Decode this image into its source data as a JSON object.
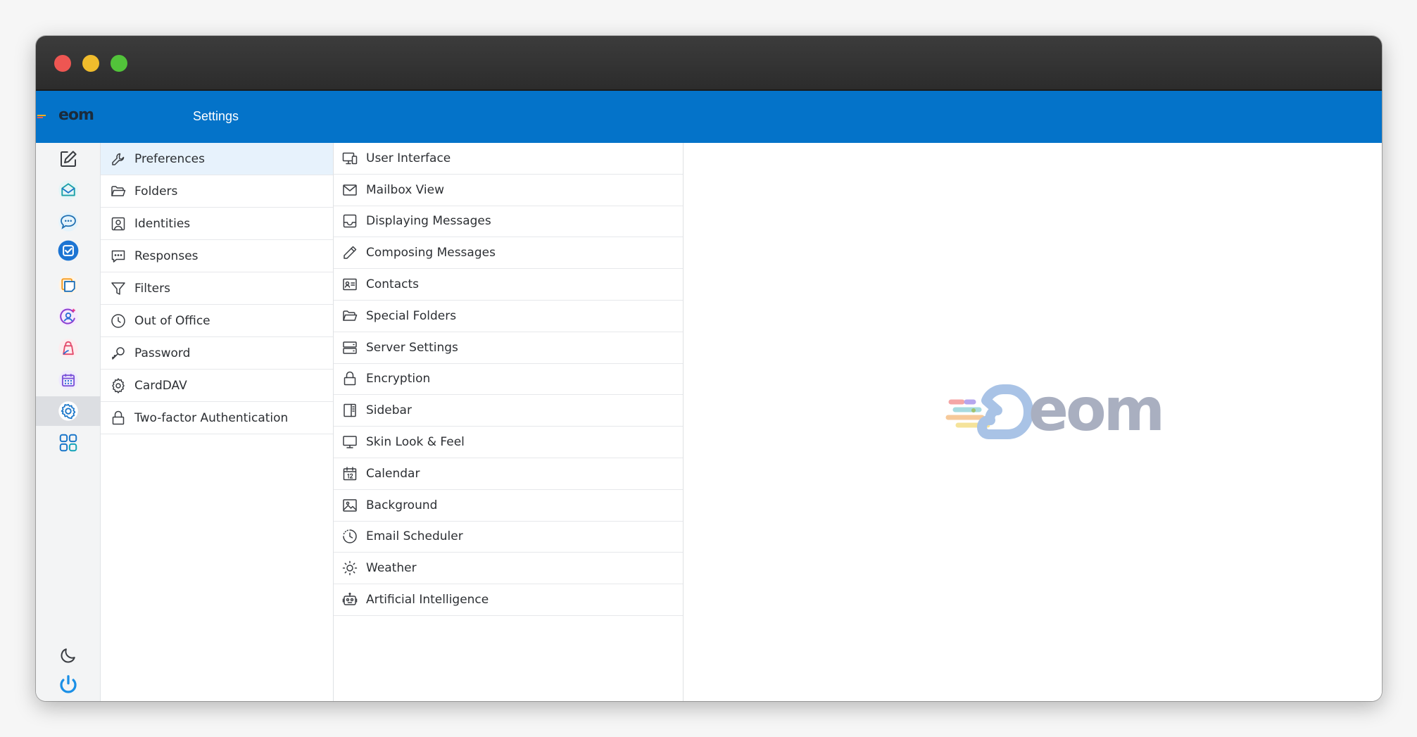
{
  "window": {
    "controls": [
      "close",
      "minimize",
      "maximize"
    ]
  },
  "app": {
    "logo_text": "eom",
    "page_title": "Settings",
    "brand_color": "#0473c9"
  },
  "rail": {
    "items": [
      {
        "name": "compose",
        "icon": "compose-icon"
      },
      {
        "name": "mail",
        "icon": "mail-icon"
      },
      {
        "name": "chat",
        "icon": "chat-icon"
      },
      {
        "name": "tasks",
        "icon": "tasks-icon"
      },
      {
        "name": "notes",
        "icon": "notes-icon"
      },
      {
        "name": "contacts",
        "icon": "contacts-icon"
      },
      {
        "name": "drive",
        "icon": "drive-icon"
      },
      {
        "name": "calendar",
        "icon": "calendar-icon"
      },
      {
        "name": "settings",
        "icon": "gear-icon",
        "active": true
      },
      {
        "name": "apps",
        "icon": "apps-grid-icon"
      }
    ],
    "bottom": [
      {
        "name": "dark-mode",
        "icon": "moon-icon"
      },
      {
        "name": "logout",
        "icon": "power-icon"
      }
    ]
  },
  "sections": [
    {
      "label": "Preferences",
      "icon": "wrench-icon",
      "selected": true
    },
    {
      "label": "Folders",
      "icon": "folder-icon"
    },
    {
      "label": "Identities",
      "icon": "identity-icon"
    },
    {
      "label": "Responses",
      "icon": "responses-icon"
    },
    {
      "label": "Filters",
      "icon": "filter-icon"
    },
    {
      "label": "Out of Office",
      "icon": "clock-icon"
    },
    {
      "label": "Password",
      "icon": "key-icon"
    },
    {
      "label": "CardDAV",
      "icon": "gear-icon"
    },
    {
      "label": "Two-factor Authentication",
      "icon": "lock-icon"
    }
  ],
  "preferences": [
    {
      "label": "User Interface",
      "icon": "devices-icon"
    },
    {
      "label": "Mailbox View",
      "icon": "envelope-icon"
    },
    {
      "label": "Displaying Messages",
      "icon": "inbox-icon"
    },
    {
      "label": "Composing Messages",
      "icon": "pencil-icon"
    },
    {
      "label": "Contacts",
      "icon": "contact-card-icon"
    },
    {
      "label": "Special Folders",
      "icon": "folder-open-icon"
    },
    {
      "label": "Server Settings",
      "icon": "server-icon"
    },
    {
      "label": "Encryption",
      "icon": "lock-icon"
    },
    {
      "label": "Sidebar",
      "icon": "sidebar-icon"
    },
    {
      "label": "Skin Look & Feel",
      "icon": "monitor-icon"
    },
    {
      "label": "Calendar",
      "icon": "calendar-12-icon"
    },
    {
      "label": "Background",
      "icon": "image-icon"
    },
    {
      "label": "Email Scheduler",
      "icon": "schedule-icon"
    },
    {
      "label": "Weather",
      "icon": "sun-icon"
    },
    {
      "label": "Artificial Intelligence",
      "icon": "robot-icon"
    }
  ],
  "content": {
    "watermark_text": "eom"
  }
}
